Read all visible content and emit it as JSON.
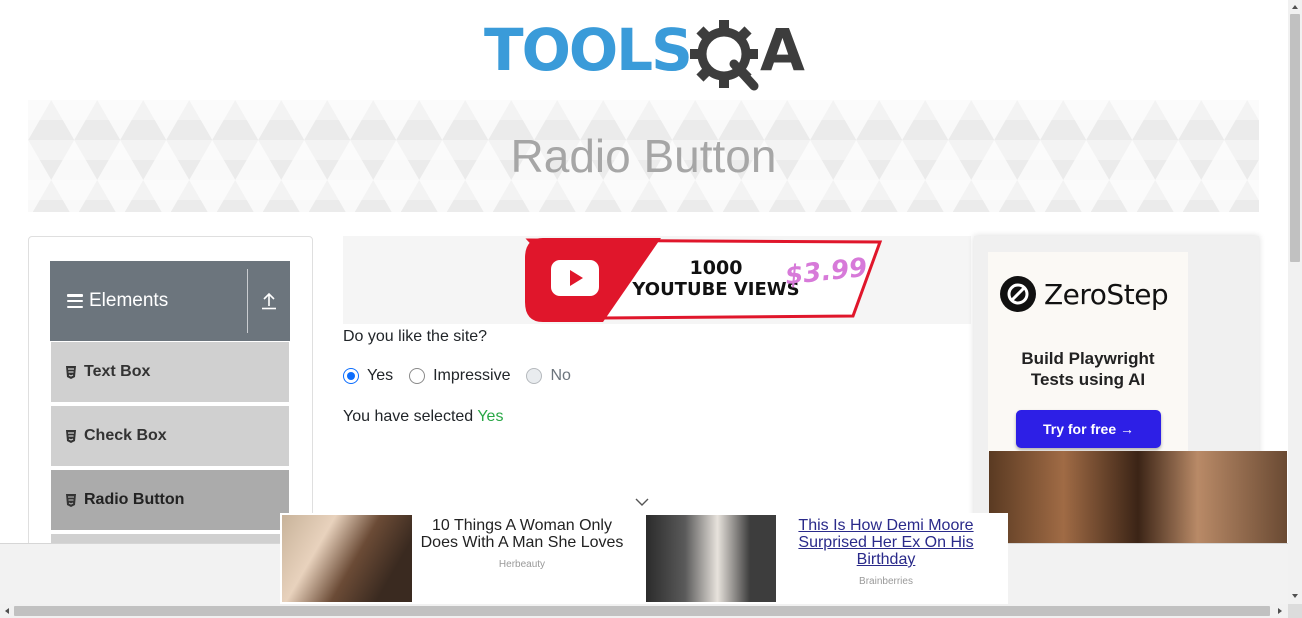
{
  "logo": {
    "text_left": "TOOLS",
    "text_right": "A",
    "mark": "gear-magnifier"
  },
  "banner": {
    "title": "Radio Button"
  },
  "sidebar": {
    "group": {
      "label": "Elements",
      "icon": "hamburger-icon",
      "toggle_icon": "collapse-up-icon"
    },
    "items": [
      {
        "label": "Text Box"
      },
      {
        "label": "Check Box"
      },
      {
        "label": "Radio Button"
      }
    ]
  },
  "top_ad": {
    "line1": "1000",
    "line2": "YOUTUBE VIEWS",
    "price": "$3.99"
  },
  "form": {
    "question": "Do you like the site?",
    "options": [
      {
        "label": "Yes",
        "checked": true,
        "disabled": false
      },
      {
        "label": "Impressive",
        "checked": false,
        "disabled": false
      },
      {
        "label": "No",
        "checked": false,
        "disabled": true
      }
    ],
    "result_prefix": "You have selected ",
    "result_value": "Yes"
  },
  "right_ad": {
    "brand": "ZeroStep",
    "tagline_line1": "Build Playwright",
    "tagline_line2": "Tests using AI",
    "cta": "Try for free →"
  },
  "bottom_ads": [
    {
      "headline": "10 Things A Woman Only Does With A Man She Loves",
      "source": "Herbeauty"
    },
    {
      "headline": "This Is How Demi Moore Surprised Her Ex On His Birthday",
      "source": "Brainberries"
    }
  ],
  "colors": {
    "accent": "#0d6efd",
    "success": "#28a745",
    "sidebar_header": "#6c757d",
    "logo_blue": "#3a9bd9",
    "logo_dark": "#3d3d3d",
    "cta": "#2d1fe6"
  }
}
